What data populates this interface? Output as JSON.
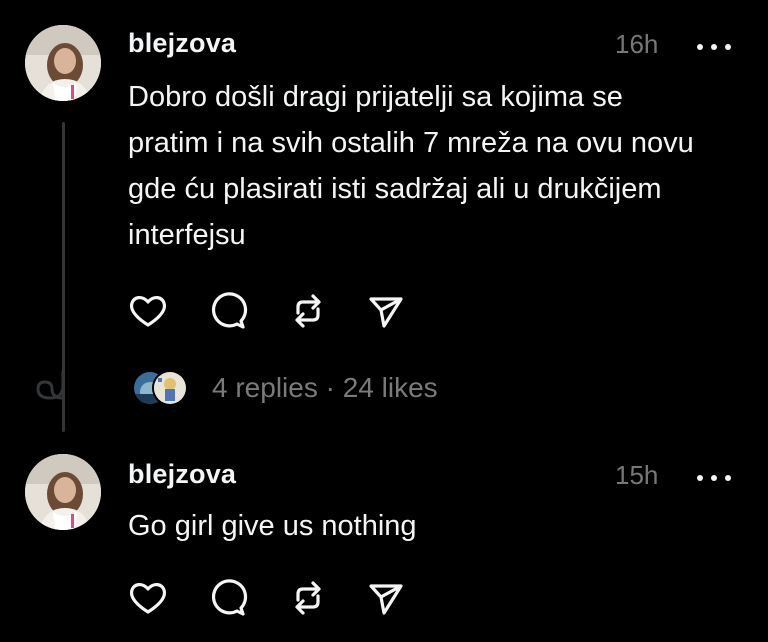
{
  "posts": [
    {
      "username": "blejzova",
      "time": "16h",
      "text": "Dobro došli dragi prijatelji sa kojima se pratim i na svih ostalih 7 mreža na ovu novu gde ću plasirati isti sadržaj ali u drukčijem interfejsu",
      "replies_label": "4 replies",
      "separator": "·",
      "likes_label": "24 likes"
    },
    {
      "username": "blejzova",
      "time": "15h",
      "text": "Go girl give us nothing"
    }
  ],
  "icons": {
    "like": "heart-icon",
    "comment": "comment-icon",
    "repost": "repost-icon",
    "share": "send-icon",
    "more": "more-icon",
    "thread_loop": "thread-loop-icon"
  },
  "colors": {
    "background": "#000000",
    "text": "#f3f5f7",
    "muted": "#777777",
    "thread_line": "#333638"
  }
}
